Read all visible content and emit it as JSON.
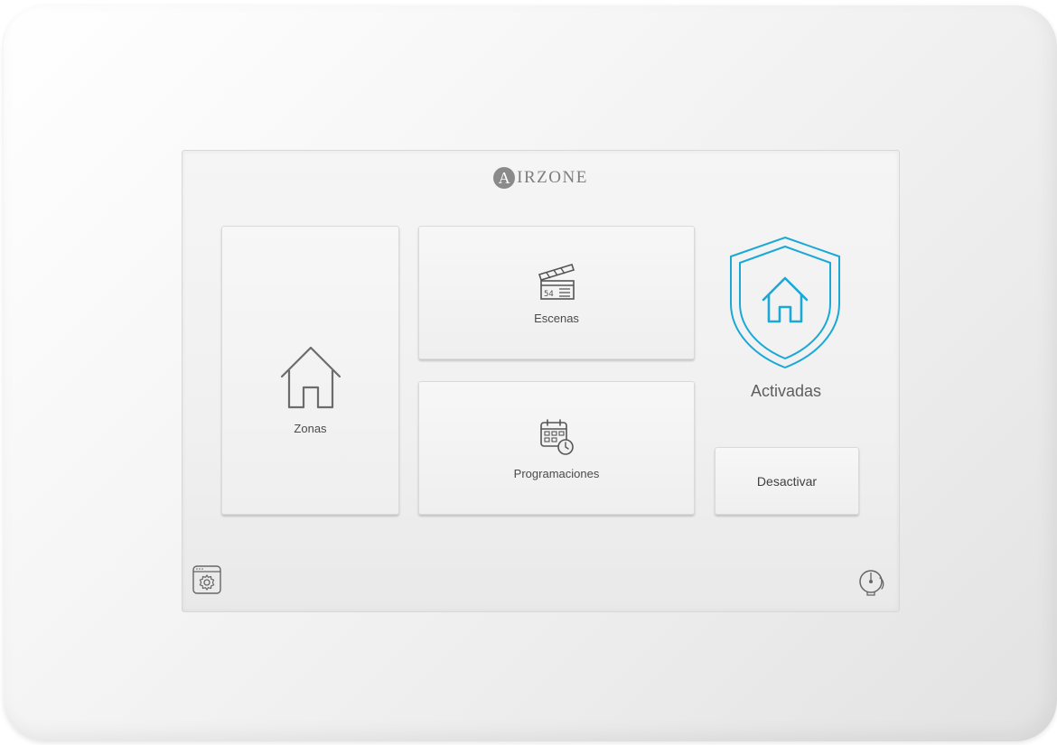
{
  "header": {
    "logo_letter": "A",
    "logo_text": "IRZONE"
  },
  "tiles": {
    "zonas": {
      "label": "Zonas",
      "icon": "house-icon"
    },
    "escenas": {
      "label": "Escenas",
      "icon": "clapperboard-icon"
    },
    "programaciones": {
      "label": "Programaciones",
      "icon": "calendar-clock-icon"
    }
  },
  "security": {
    "status": "Activadas",
    "icon": "shield-house-icon",
    "action_label": "Desactivar",
    "accent_color": "#1aa9d6"
  },
  "footer": {
    "left_icon": "settings-gear-icon",
    "right_icon": "alarm-bell-icon"
  }
}
